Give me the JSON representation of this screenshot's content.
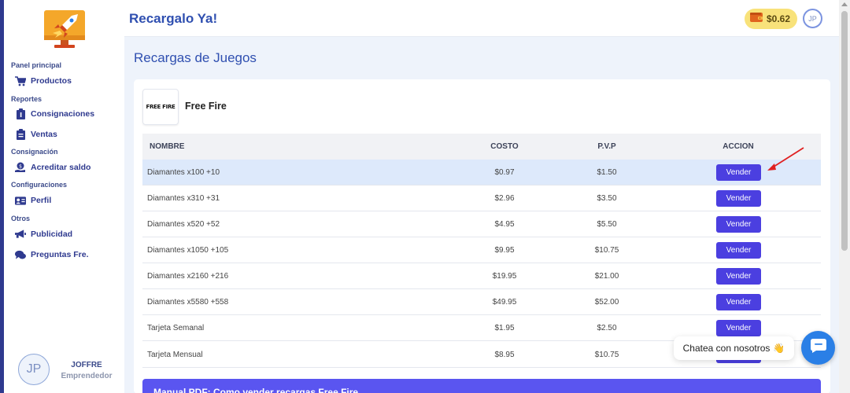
{
  "header": {
    "app_title": "Recargalo Ya!",
    "balance": "$0.62",
    "avatar_initials": "JP"
  },
  "sidebar": {
    "sections": [
      {
        "title": "Panel principal",
        "items": [
          {
            "label": "Productos",
            "icon": "cart-icon"
          }
        ]
      },
      {
        "title": "Reportes",
        "items": [
          {
            "label": "Consignaciones",
            "icon": "clipboard-icon"
          },
          {
            "label": "Ventas",
            "icon": "clipboard-list-icon"
          }
        ]
      },
      {
        "title": "Consignación",
        "items": [
          {
            "label": "Acreditar saldo",
            "icon": "coin-hand-icon"
          }
        ]
      },
      {
        "title": "Configuraciones",
        "items": [
          {
            "label": "Perfil",
            "icon": "id-card-icon"
          }
        ]
      },
      {
        "title": "Otros",
        "items": [
          {
            "label": "Publicidad",
            "icon": "megaphone-icon"
          },
          {
            "label": "Preguntas Fre.",
            "icon": "chat-bubbles-icon"
          }
        ]
      }
    ],
    "user": {
      "initials": "JP",
      "name": "JOFFRE",
      "role": "Emprendedor"
    }
  },
  "main": {
    "page_title": "Recargas de Juegos",
    "game": {
      "logo_text": "FREE FIRE",
      "name": "Free Fire"
    },
    "table": {
      "headers": {
        "name": "NOMBRE",
        "cost": "COSTO",
        "pvp": "P.V.P",
        "action": "ACCION"
      },
      "action_label": "Vender",
      "rows": [
        {
          "name": "Diamantes x100 +10",
          "cost": "$0.97",
          "pvp": "$1.50"
        },
        {
          "name": "Diamantes x310 +31",
          "cost": "$2.96",
          "pvp": "$3.50"
        },
        {
          "name": "Diamantes x520 +52",
          "cost": "$4.95",
          "pvp": "$5.50"
        },
        {
          "name": "Diamantes x1050 +105",
          "cost": "$9.95",
          "pvp": "$10.75"
        },
        {
          "name": "Diamantes x2160 +216",
          "cost": "$19.95",
          "pvp": "$21.00"
        },
        {
          "name": "Diamantes x5580 +558",
          "cost": "$49.95",
          "pvp": "$52.00"
        },
        {
          "name": "Tarjeta Semanal",
          "cost": "$1.95",
          "pvp": "$2.50"
        },
        {
          "name": "Tarjeta Mensual",
          "cost": "$8.95",
          "pvp": "$10.75"
        }
      ]
    },
    "manual_title": "Manual PDF: Como vender recargas Free Fire"
  },
  "chat": {
    "label": "Chatea con nosotros",
    "emoji": "👋"
  },
  "colors": {
    "accent": "#4b3fe0",
    "brand_blue": "#2f4fb0",
    "highlight_row": "#dde9fb",
    "chat_blue": "#2a7fe6",
    "annotation_red": "#e02020"
  }
}
